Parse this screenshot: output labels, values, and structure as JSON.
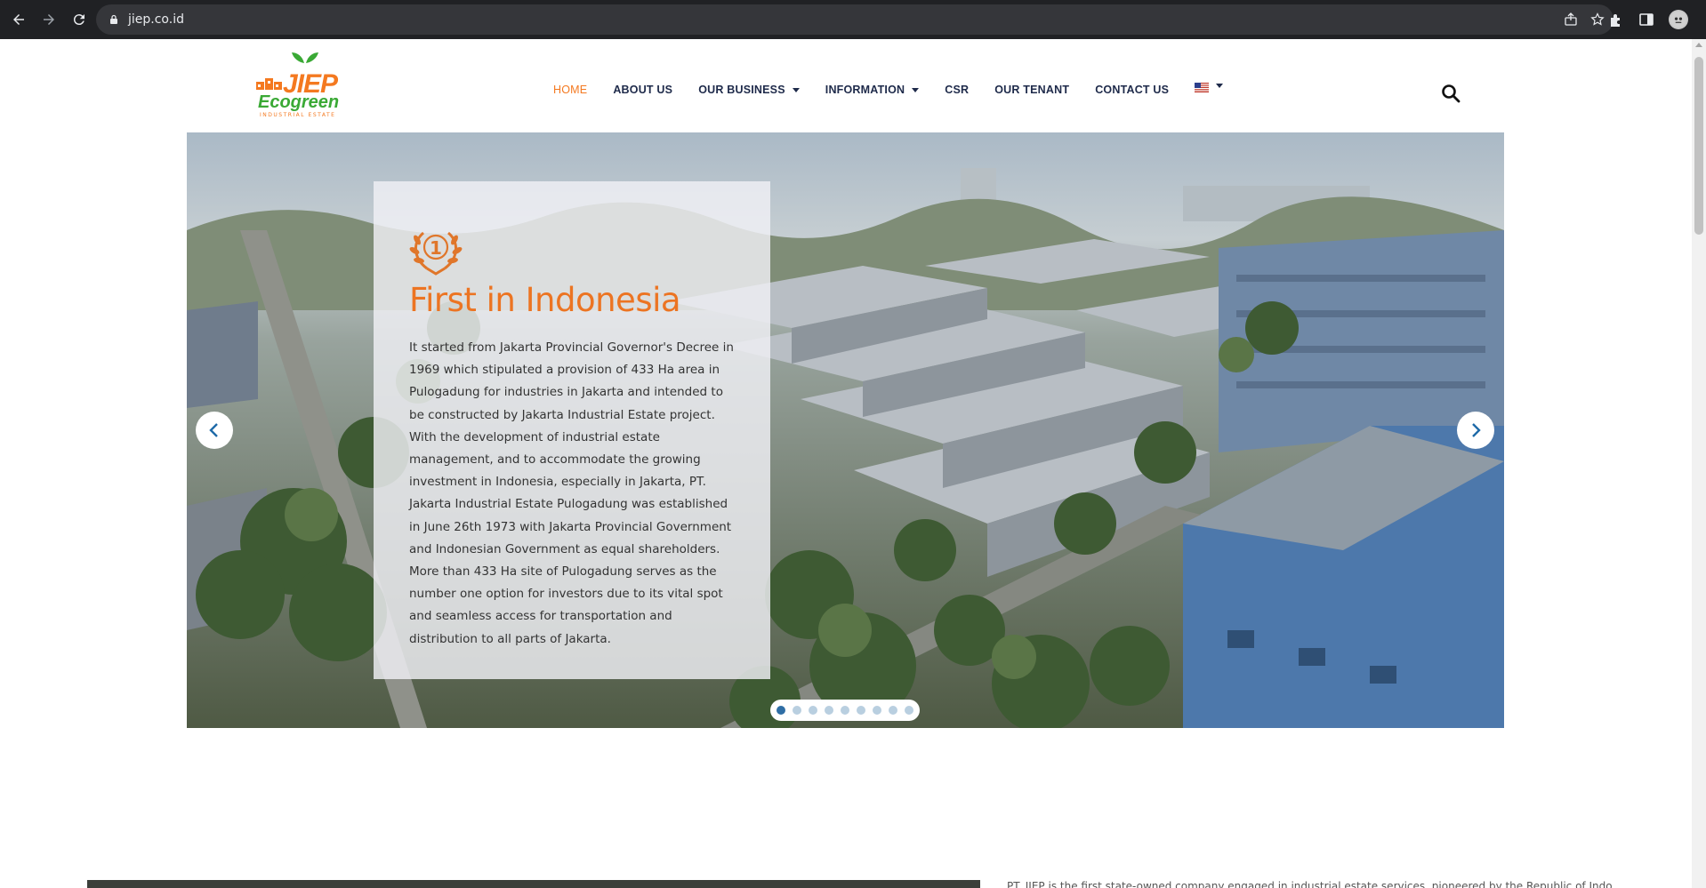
{
  "browser": {
    "url": "jiep.co.id",
    "icons": [
      "back-arrow-icon",
      "forward-arrow-icon",
      "reload-icon",
      "lock-icon",
      "share-icon",
      "star-icon",
      "puzzle-icon",
      "sidepanel-icon",
      "profile-avatar"
    ]
  },
  "site": {
    "logo": {
      "name": "JIEP",
      "tagline": "Ecogreen",
      "sub": "INDUSTRIAL ESTATE"
    },
    "menu": [
      {
        "label": "HOME",
        "active": true,
        "dropdown": false
      },
      {
        "label": "ABOUT US",
        "active": false,
        "dropdown": false
      },
      {
        "label": "OUR BUSINESS",
        "active": false,
        "dropdown": true
      },
      {
        "label": "INFORMATION",
        "active": false,
        "dropdown": true
      },
      {
        "label": "CSR",
        "active": false,
        "dropdown": false
      },
      {
        "label": "OUR TENANT",
        "active": false,
        "dropdown": false
      },
      {
        "label": "CONTACT US",
        "active": false,
        "dropdown": false
      }
    ],
    "language_flag": "us-flag-icon",
    "search_icon": "search-icon",
    "colors": {
      "accent": "#f47920",
      "green": "#3aa935",
      "nav_text": "#1e2a4a"
    }
  },
  "slider": {
    "award_icon": "number-one-laurel-icon",
    "title": "First in Indonesia",
    "text": "It started from Jakarta Provincial Governor's Decree in 1969 which stipulated a provision of 433 Ha area in Pulogadung for industries in Jakarta and intended to be constructed by Jakarta Industrial Estate project. With the development of industrial estate management, and to accommodate the growing investment in Indonesia, especially in Jakarta, PT. Jakarta Industrial Estate Pulogadung was established in June 26th 1973 with Jakarta Provincial Government and Indonesian Government as equal shareholders. More than 433 Ha site of Pulogadung serves as the number one option for investors due to its vital spot and seamless access for transportation and distribution to all parts of Jakarta.",
    "slide_count": 9,
    "active_slide": 1
  },
  "below": {
    "text": "PT. JIEP is the first state-owned company engaged in industrial estate services, pioneered by the Republic of Indonesia"
  }
}
